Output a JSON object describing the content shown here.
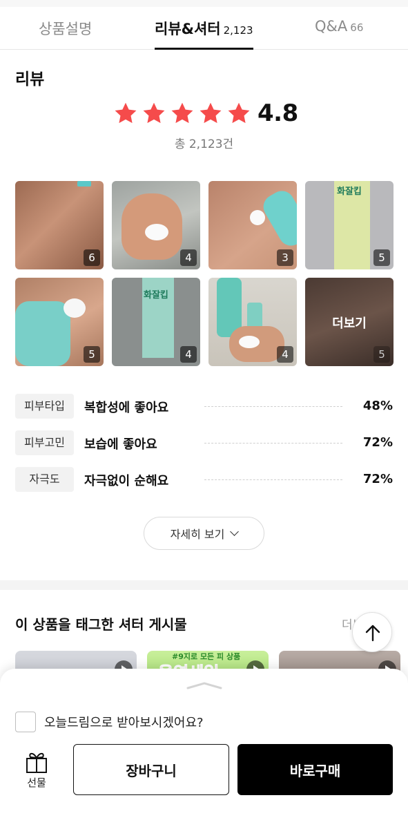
{
  "tabs": [
    {
      "label": "상품설명",
      "count": ""
    },
    {
      "label": "리뷰&셔터",
      "count": "2,123"
    },
    {
      "label": "Q&A",
      "count": "66"
    }
  ],
  "review": {
    "title": "리뷰",
    "rating": "4.8",
    "rating_value": 4.8,
    "star_color": "#f54b4b",
    "total": "총 2,123건"
  },
  "photos": [
    {
      "count": "6"
    },
    {
      "count": "4"
    },
    {
      "count": "3"
    },
    {
      "count": "5"
    },
    {
      "count": "5"
    },
    {
      "count": "4"
    },
    {
      "count": "4"
    },
    {
      "count": "5",
      "overlay": "더보기"
    }
  ],
  "attributes": [
    {
      "chip": "피부타입",
      "text": "복합성에 좋아요",
      "percent": "48%"
    },
    {
      "chip": "피부고민",
      "text": "보습에 좋아요",
      "percent": "72%"
    },
    {
      "chip": "자극도",
      "text": "자극없이 순해요",
      "percent": "72%"
    }
  ],
  "detail_button": "자세히 보기",
  "shutter": {
    "title": "이 상품을 태그한 셔터 게시물",
    "more": "더보기",
    "thumbs": [
      {
        "caption": "",
        "big": ""
      },
      {
        "caption": "#9지로 모든 피 상품",
        "big": "올영세일"
      },
      {
        "caption": "",
        "big": ""
      }
    ]
  },
  "bottom_sheet": {
    "checkbox_label": "오늘드림으로 받아보시겠어요?",
    "gift_label": "선물",
    "cart_button": "장바구니",
    "buy_button": "바로구매"
  }
}
